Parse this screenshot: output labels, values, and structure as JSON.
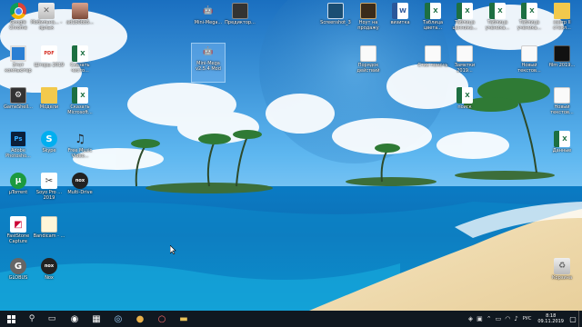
{
  "desktop": {
    "icons": [
      {
        "id": "chrome",
        "label": "Google Chrome",
        "glyph": "",
        "style": "g-chrome"
      },
      {
        "id": "trash",
        "label": "Мобильна... - ярлык",
        "glyph": "✕",
        "style": "g-recycle"
      },
      {
        "id": "photo",
        "label": "ad1b0bb5...",
        "glyph": "",
        "style": "g-photo"
      },
      {
        "id": "android1",
        "label": "Mini-Mega...",
        "glyph": "🤖",
        "style": "g-android"
      },
      {
        "id": "game",
        "label": "Предиктор...",
        "glyph": "",
        "style": "g-game"
      },
      {
        "id": "screenshot",
        "label": "Screenshot_3",
        "glyph": "",
        "style": "g-screen"
      },
      {
        "id": "notebook",
        "label": "Ноут на продажу",
        "glyph": "",
        "style": "g-book"
      },
      {
        "id": "word1",
        "label": "визитка",
        "glyph": "W",
        "style": "g-word"
      },
      {
        "id": "excel1",
        "label": "Таблица цвета...",
        "glyph": "X",
        "style": "g-excel"
      },
      {
        "id": "excel2",
        "label": "Таблица ценника...",
        "glyph": "X",
        "style": "g-excel"
      },
      {
        "id": "excel3",
        "label": "Таблица ученика...",
        "glyph": "X",
        "style": "g-excel"
      },
      {
        "id": "excel4",
        "label": "Таблица ученика...",
        "glyph": "X",
        "style": "g-excel"
      },
      {
        "id": "folder1",
        "label": "завтр II стекл...",
        "glyph": "",
        "style": "g-folder"
      },
      {
        "id": "computer",
        "label": "Этот компьютер",
        "glyph": "",
        "style": "g-monitor"
      },
      {
        "id": "pdf",
        "label": "Шторы 2019",
        "glyph": "PDF",
        "style": "g-pdf"
      },
      {
        "id": "excel5",
        "label": "Сказать чисто...",
        "glyph": "X",
        "style": "g-excel"
      },
      {
        "id": "android2",
        "label": "Mini-Mega v2.5.4 Mod",
        "glyph": "🤖",
        "style": "g-android"
      },
      {
        "id": "file1",
        "label": "Порядок действий",
        "glyph": "",
        "style": "g-file"
      },
      {
        "id": "file2",
        "label": "Стих помочь",
        "glyph": "",
        "style": "g-file"
      },
      {
        "id": "file3",
        "label": "Заметки 2019...",
        "glyph": "",
        "style": "g-file"
      },
      {
        "id": "file4",
        "label": "Новый текстов...",
        "glyph": "",
        "style": "g-file"
      },
      {
        "id": "video1",
        "label": "film 2019...",
        "glyph": "",
        "style": "g-video"
      },
      {
        "id": "gamer",
        "label": "GameShell...",
        "glyph": "⚙",
        "style": "g-game"
      },
      {
        "id": "folder2",
        "label": "Модели",
        "glyph": "",
        "style": "g-folder"
      },
      {
        "id": "excel6",
        "label": "Сказать Microsoft...",
        "glyph": "X",
        "style": "g-excel"
      },
      {
        "id": "excel7",
        "label": "поиск",
        "glyph": "X",
        "style": "g-excel"
      },
      {
        "id": "file5",
        "label": "Новый текстов...",
        "glyph": "",
        "style": "g-file"
      },
      {
        "id": "ps",
        "label": "Adobe Photosho...",
        "glyph": "Ps",
        "style": "g-ps"
      },
      {
        "id": "skype",
        "label": "Skype",
        "glyph": "S",
        "style": "g-skype"
      },
      {
        "id": "mp3",
        "label": "Free Music Video...",
        "glyph": "♫",
        "style": "g-mp3"
      },
      {
        "id": "excel8",
        "label": "Данные",
        "glyph": "X",
        "style": "g-excel"
      },
      {
        "id": "utorrent",
        "label": "µTorrent",
        "glyph": "µ",
        "style": "g-utorrent"
      },
      {
        "id": "movavi",
        "label": "Soyo Pro ... 2019",
        "glyph": "✂",
        "style": "g-movavi"
      },
      {
        "id": "nox1",
        "label": "Multi-Drive",
        "glyph": "nox",
        "style": "g-nox"
      },
      {
        "id": "faststone",
        "label": "FastStone Capture",
        "glyph": "◩",
        "style": "g-faststone"
      },
      {
        "id": "bandicam",
        "label": "Bandicam - ...",
        "glyph": "",
        "style": "g-bandicam"
      },
      {
        "id": "globus",
        "label": "GLOBUS",
        "glyph": "G",
        "style": "g-globus"
      },
      {
        "id": "nox2",
        "label": "Nox",
        "glyph": "nox",
        "style": "g-nox"
      },
      {
        "id": "recycle",
        "label": "Корзина",
        "glyph": "♻",
        "style": "g-recycle"
      }
    ]
  },
  "taskbar": {
    "pinned": [
      {
        "id": "search",
        "glyph": "⚲"
      },
      {
        "id": "taskview",
        "glyph": "▭"
      },
      {
        "id": "media",
        "glyph": "◉"
      },
      {
        "id": "calc",
        "glyph": "▦"
      },
      {
        "id": "browser",
        "glyph": "◎"
      },
      {
        "id": "chrome",
        "glyph": "●"
      },
      {
        "id": "opera",
        "glyph": "○"
      },
      {
        "id": "folder",
        "glyph": "▬"
      }
    ],
    "colors": {
      "search": "#ffffff",
      "taskview": "#ffffff",
      "media": "#ffffff",
      "calc": "#ffffff",
      "browser": "#9fd3ff",
      "chrome": "#e8b04a",
      "opera": "#ff6b6b",
      "folder": "#e8c25a"
    },
    "tray": {
      "lang": "РУС",
      "time": "8:18",
      "date": "09.11.2019"
    }
  }
}
